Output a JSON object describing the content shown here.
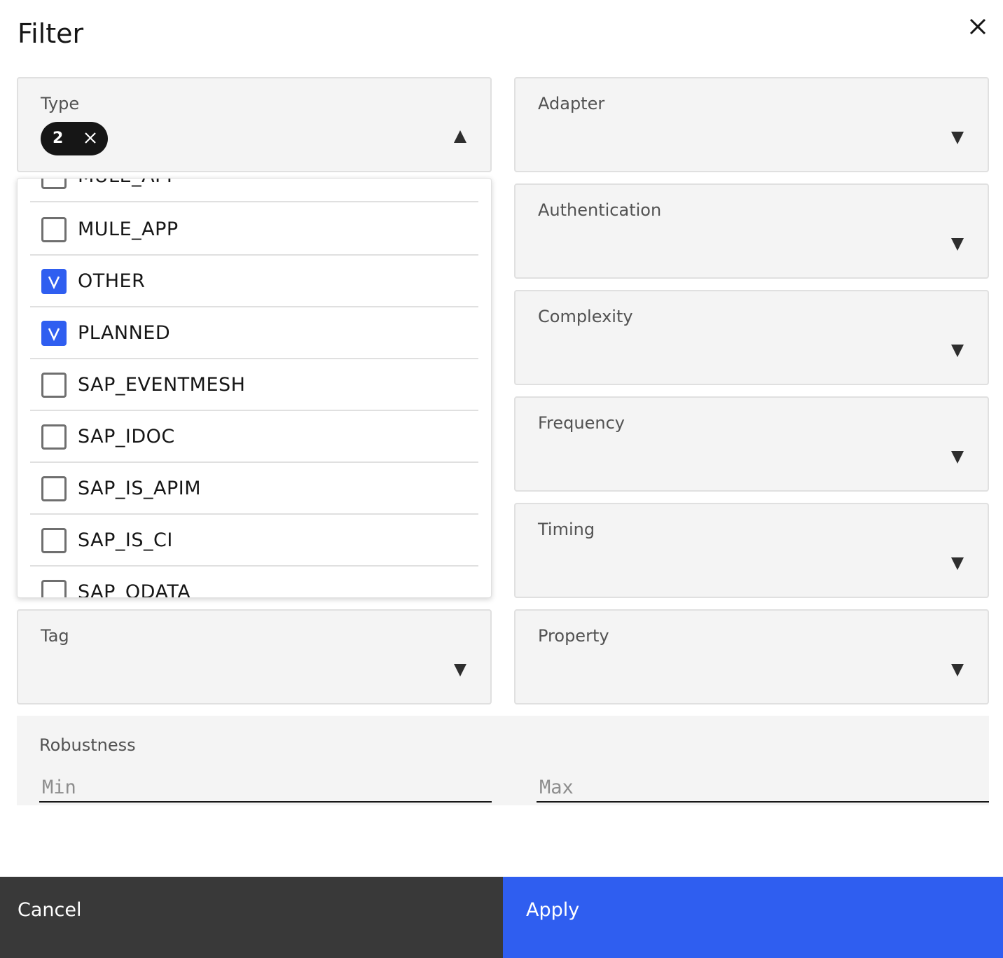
{
  "modal": {
    "title": "Filter"
  },
  "type_filter": {
    "label": "Type",
    "selected_count": "2",
    "options": [
      {
        "label": "MULE_API",
        "checked": false
      },
      {
        "label": "MULE_APP",
        "checked": false
      },
      {
        "label": "OTHER",
        "checked": true
      },
      {
        "label": "PLANNED",
        "checked": true
      },
      {
        "label": "SAP_EVENTMESH",
        "checked": false
      },
      {
        "label": "SAP_IDOC",
        "checked": false
      },
      {
        "label": "SAP_IS_APIM",
        "checked": false
      },
      {
        "label": "SAP_IS_CI",
        "checked": false
      },
      {
        "label": "SAP_ODATA",
        "checked": false
      }
    ]
  },
  "filters": {
    "adapter": "Adapter",
    "authentication": "Authentication",
    "complexity": "Complexity",
    "frequency": "Frequency",
    "timing": "Timing",
    "tag": "Tag",
    "property": "Property"
  },
  "robustness": {
    "label": "Robustness",
    "min_placeholder": "Min",
    "max_placeholder": "Max",
    "min_value": "",
    "max_value": ""
  },
  "footer": {
    "cancel_label": "Cancel",
    "apply_label": "Apply",
    "cancel_color": "#393939",
    "apply_color": "#2f5ef0"
  }
}
